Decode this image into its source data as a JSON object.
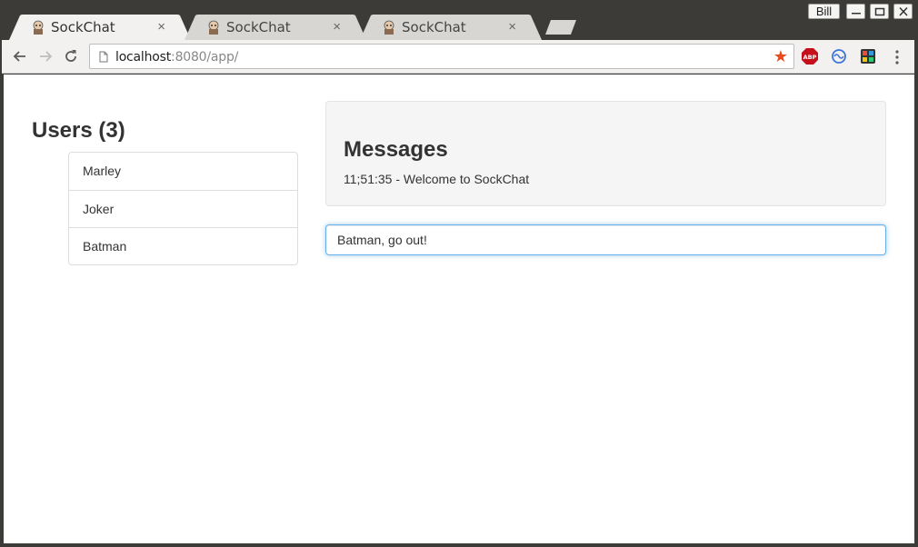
{
  "browser": {
    "tabs": [
      {
        "title": "SockChat",
        "close": "×",
        "active": true
      },
      {
        "title": "SockChat",
        "close": "×",
        "active": false
      },
      {
        "title": "SockChat",
        "close": "×",
        "active": false
      }
    ],
    "profile_name": "Bill",
    "url_host": "localhost",
    "url_rest": ":8080/app/",
    "icons": [
      "back-arrow-icon",
      "forward-arrow-icon",
      "reload-icon",
      "page-icon",
      "bookmark-star-icon",
      "adblock-icon",
      "sync-icon",
      "extension-icon",
      "menu-dots-icon"
    ],
    "colors": {
      "star": "#e8491d",
      "adblock": "#c5101b",
      "input_focus": "#66afe9"
    }
  },
  "app": {
    "users_heading": "Users (3)",
    "users": [
      "Marley",
      "Joker",
      "Batman"
    ],
    "messages_heading": "Messages",
    "messages": [
      "11;51:35 - Welcome to SockChat"
    ],
    "input_value": "Batman, go out!"
  }
}
